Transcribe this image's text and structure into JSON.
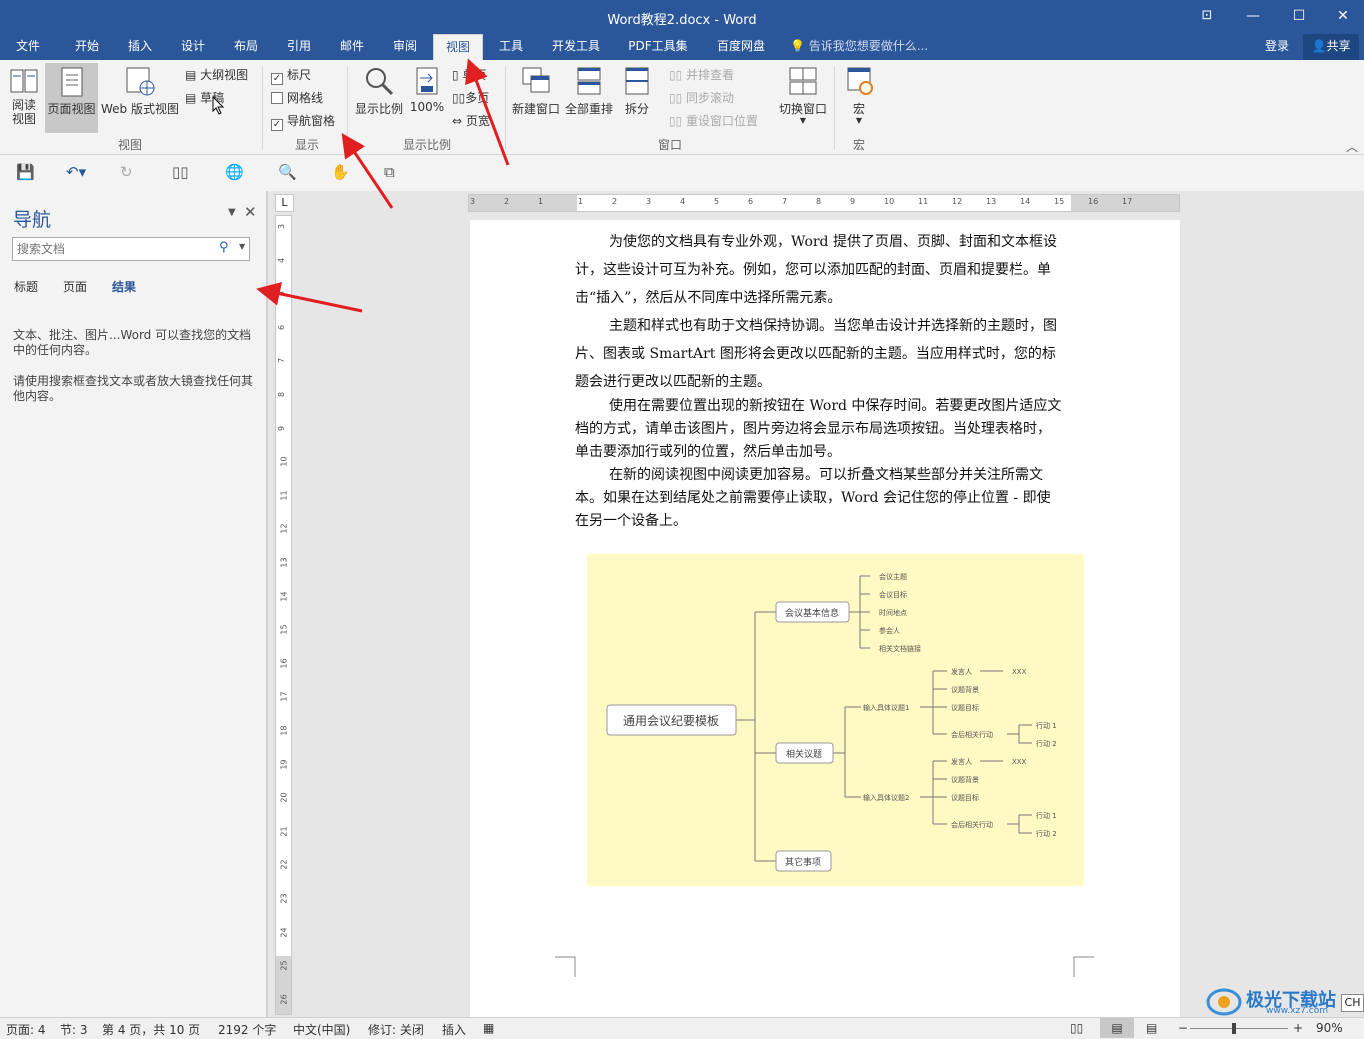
{
  "window": {
    "title": "Word教程2.docx - Word",
    "restore_icon": "ribbon-display-icon",
    "min": "—",
    "max": "☐",
    "close": "✕"
  },
  "tabs": [
    "文件",
    "开始",
    "插入",
    "设计",
    "布局",
    "引用",
    "邮件",
    "审阅",
    "视图",
    "工具",
    "开发工具",
    "PDF工具集",
    "百度网盘"
  ],
  "active_tab": "视图",
  "tell_me": "告诉我您想要做什么...",
  "login": "登录",
  "share": "共享",
  "ribbon": {
    "views": {
      "read_mode": "阅读\n视图",
      "read_mode_1": "阅读",
      "read_mode_2": "视图",
      "print_layout": "页面视图",
      "web_layout": "Web 版式视图",
      "outline": "大纲视图",
      "draft": "草稿",
      "group": "视图"
    },
    "show": {
      "ruler": "标尺",
      "gridlines": "网格线",
      "nav_pane": "导航窗格",
      "group": "显示"
    },
    "zoom": {
      "zoom": "显示比例",
      "hundred": "100%",
      "one_page": "单页",
      "multi_page": "多页",
      "page_width": "页宽",
      "group": "显示比例"
    },
    "window": {
      "new_window": "新建窗口",
      "arrange_all": "全部重排",
      "split": "拆分",
      "side_by_side": "并排查看",
      "sync_scroll": "同步滚动",
      "reset_pos": "重设窗口位置",
      "switch_window": "切换窗口",
      "group": "窗口"
    },
    "macros": {
      "macro": "宏",
      "group": "宏"
    }
  },
  "nav_pane": {
    "title": "导航",
    "search_placeholder": "搜索文档",
    "tab_headings": "标题",
    "tab_pages": "页面",
    "tab_results": "结果",
    "hint1": "文本、批注、图片...Word 可以查找您的文档中的任何内容。",
    "hint2": "请使用搜索框查找文本或者放大镜查找任何其他内容。"
  },
  "document": {
    "para1_l1": "为使您的文档具有专业外观，Word 提供了页眉、页脚、封面和文本框设",
    "para1_l2": "计，这些设计可互为补充。例如，您可以添加匹配的封面、页眉和提要栏。单",
    "para1_l3": "击“插入”，然后从不同库中选择所需元素。",
    "para2_l1": "主题和样式也有助于文档保持协调。当您单击设计并选择新的主题时，图",
    "para2_l2": "片、图表或 SmartArt 图形将会更改以匹配新的主题。当应用样式时，您的标",
    "para2_l3": "题会进行更改以匹配新的主题。",
    "para3_l1": "使用在需要位置出现的新按钮在 Word 中保存时间。若要更改图片适应文",
    "para3_l2": "档的方式，请单击该图片，图片旁边将会显示布局选项按钮。当处理表格时，",
    "para3_l3": "单击要添加行或列的位置，然后单击加号。",
    "para4_l1": "在新的阅读视图中阅读更加容易。可以折叠文档某些部分并关注所需文",
    "para4_l2": "本。如果在达到结尾处之前需要停止读取，Word 会记住您的停止位置 - 即使",
    "para4_l3": "在另一个设备上。"
  },
  "mindmap": {
    "root": "通用会议纪要模板",
    "b1": "会议基本信息",
    "b1_items": [
      "会议主题",
      "会议目标",
      "时间地点",
      "参会人",
      "相关文档链接"
    ],
    "b2": "相关议题",
    "topic1": "输入具体议题1",
    "topic2": "输入具体议题2",
    "presenter": "发言人",
    "xxx": "XXX",
    "background": "议题背景",
    "goal": "议题目标",
    "followup": "会后相关行动",
    "action1": "行动 1",
    "action2": "行动 2",
    "b3": "其它事项"
  },
  "hruler_nums": [
    "3",
    "2",
    "1",
    "1",
    "2",
    "3",
    "4",
    "5",
    "6",
    "7",
    "8",
    "9",
    "10",
    "11",
    "12",
    "13",
    "14",
    "15",
    "16",
    "17"
  ],
  "vruler_nums": [
    "3",
    "4",
    "5",
    "6",
    "7",
    "8",
    "9",
    "10",
    "11",
    "12",
    "13",
    "14",
    "15",
    "16",
    "17",
    "18",
    "19",
    "20",
    "21",
    "22",
    "23",
    "24",
    "25",
    "26"
  ],
  "status": {
    "page": "页面: 4",
    "section": "节: 3",
    "page_of": "第 4 页，共 10 页",
    "words": "2192 个字",
    "lang": "中文(中国)",
    "track": "修订: 关闭",
    "insert": "插入",
    "zoom_pct": "90%"
  },
  "watermark": "极光下载站",
  "watermark_url": "www.xz7.com",
  "ime": "CH",
  "colors": {
    "accent": "#2b579a",
    "arrow": "#e02020",
    "mindmap_bg": "#fff9c4"
  }
}
